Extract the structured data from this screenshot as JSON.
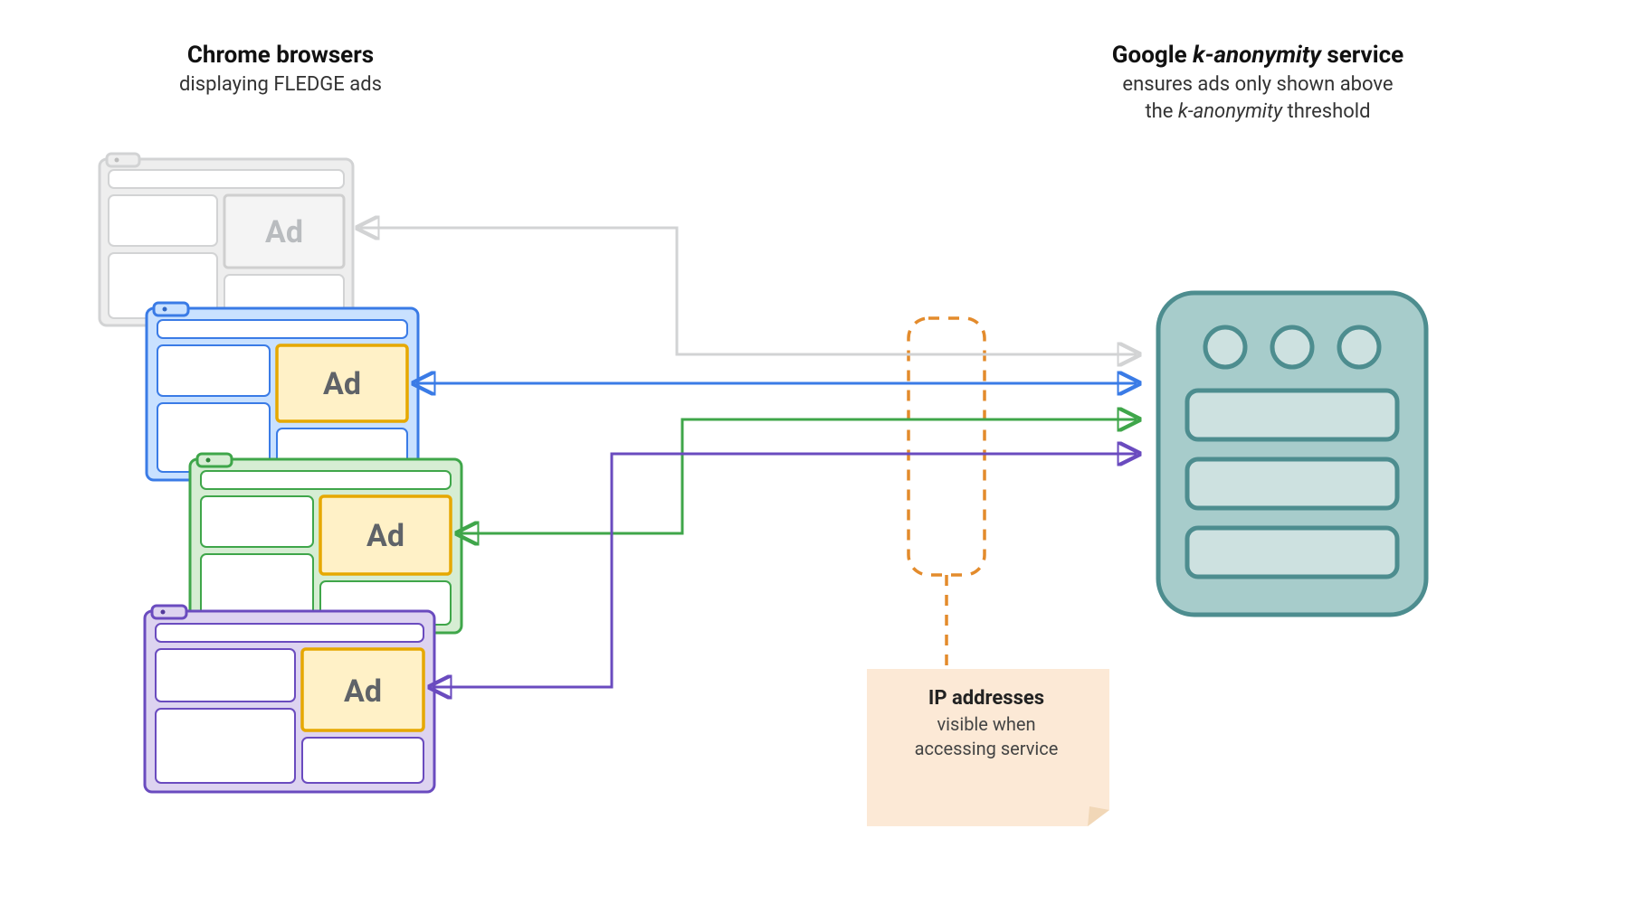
{
  "left_title": {
    "bold": "Chrome browsers",
    "sub": "displaying FLEDGE ads"
  },
  "right_title": {
    "bold_prefix": "Google ",
    "bold_italic": "k-anonymity",
    "bold_suffix": " service",
    "sub_line1_prefix": "ensures ads only shown above",
    "sub_line2_prefix": "the ",
    "sub_line2_italic": "k-anonymity",
    "sub_line2_suffix": " threshold"
  },
  "ad_label": "Ad",
  "ip_note": {
    "bold": "IP addresses",
    "line1": "visible when",
    "line2": "accessing service"
  },
  "colors": {
    "gray": "#d2d3d4",
    "blue": "#3a7be6",
    "green": "#3fa64a",
    "purple": "#6a4bbf",
    "orange": "#e38b2c",
    "note_bg": "#fce9d6",
    "server_stroke": "#4d8d8f",
    "server_fill": "#a7cccb",
    "server_inner": "#cde1e0",
    "ad_fill": "#fff1c7",
    "ad_stroke": "#e6a800",
    "blue_fill": "#c9e1ff",
    "green_fill": "#d6edd3",
    "purple_fill": "#ddd3f0",
    "gray_fill": "#eeeeee"
  }
}
